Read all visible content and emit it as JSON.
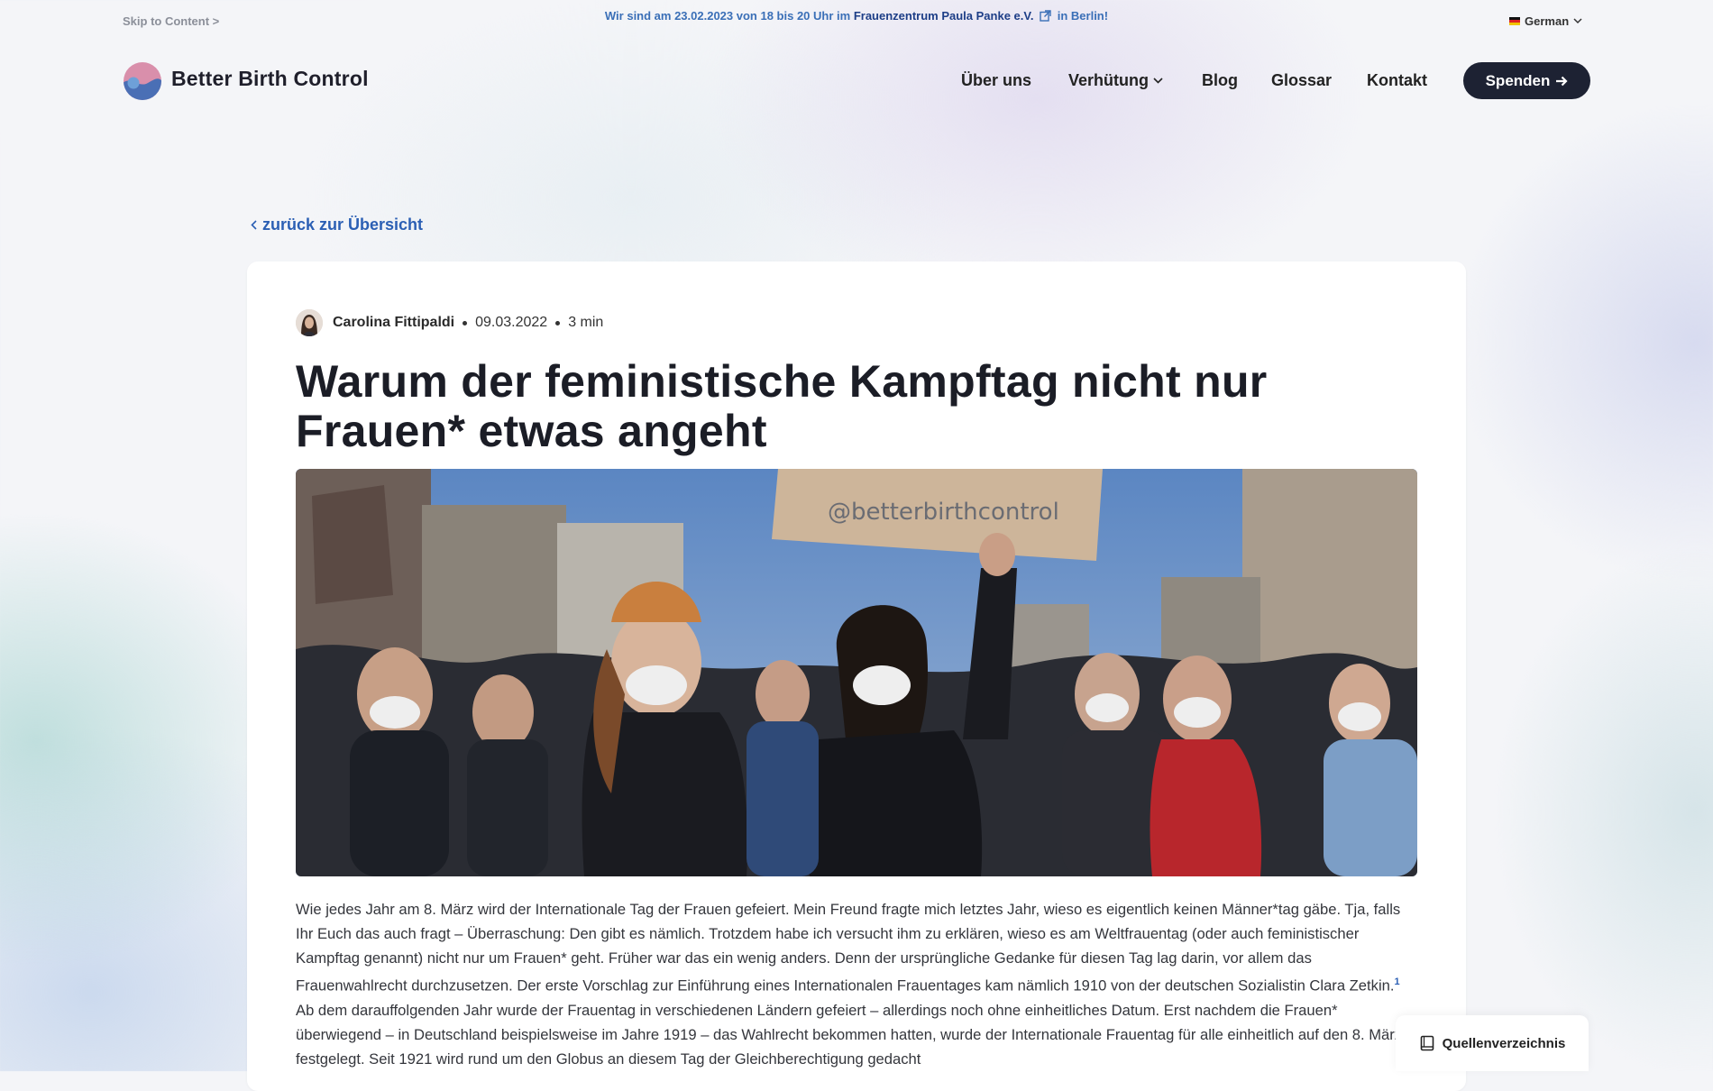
{
  "topbar": {
    "skip_link": "Skip to Content >",
    "announcement_pre": "Wir sind am 23.02.2023 von 18 bis 20 Uhr im",
    "announcement_location": "Frauenzentrum Paula Panke e.V.",
    "announcement_post": "in Berlin!",
    "language": "German"
  },
  "header": {
    "brand": "Better Birth Control",
    "nav": {
      "ueber_uns": "Über uns",
      "verhuetung": "Verhütung",
      "blog": "Blog",
      "glossar": "Glossar",
      "kontakt": "Kontakt"
    },
    "donate_label": "Spenden"
  },
  "back_link": "zurück zur Übersicht",
  "article": {
    "author": "Carolina Fittipaldi",
    "date": "09.03.2022",
    "read_time": "3 min",
    "title": "Warum der feministische Kampftag nicht nur Frauen* etwas angeht",
    "hero_sign_text": "@betterbirthcontrol",
    "body_part1": "Wie jedes Jahr am 8. März wird der Internationale Tag der Frauen gefeiert. Mein Freund fragte mich letztes Jahr, wieso es eigentlich keinen Männer*tag gäbe. Tja, falls Ihr Euch das auch fragt – Überraschung: Den gibt es nämlich. Trotzdem habe ich versucht ihm zu erklären, wieso es am Weltfrauentag (oder auch feministischer Kampftag genannt) nicht nur um Frauen* geht. Früher war das ein wenig anders. Denn der ursprüngliche Gedanke für diesen Tag lag darin, vor allem das Frauenwahlrecht durchzusetzen. Der erste Vorschlag zur Einführung eines Internationalen Frauentages kam nämlich 1910 von der deutschen Sozialistin Clara Zetkin.",
    "footnote": "1",
    "body_part2": " Ab dem darauffolgenden Jahr wurde der Frauentag in verschiedenen Ländern gefeiert – allerdings noch ohne einheitliches Datum. Erst nachdem die Frauen* überwiegend – in Deutschland beispielsweise im Jahre 1919 – das Wahlrecht bekommen hatten, wurde der Internationale Frauentag für alle einheitlich auf den 8. März festgelegt. Seit 1921 wird rund um den Globus an diesem Tag der Gleichberechtigung gedacht"
  },
  "sources_label": "Quellenverzeichnis",
  "colors": {
    "accent_blue": "#2b5fb4",
    "dark": "#1d2233",
    "announcement": "#3a6fb7"
  },
  "icons": [
    "external-link-icon",
    "chevron-down-icon",
    "arrow-right-icon",
    "chevron-left-icon",
    "book-icon",
    "germany-flag-icon"
  ]
}
